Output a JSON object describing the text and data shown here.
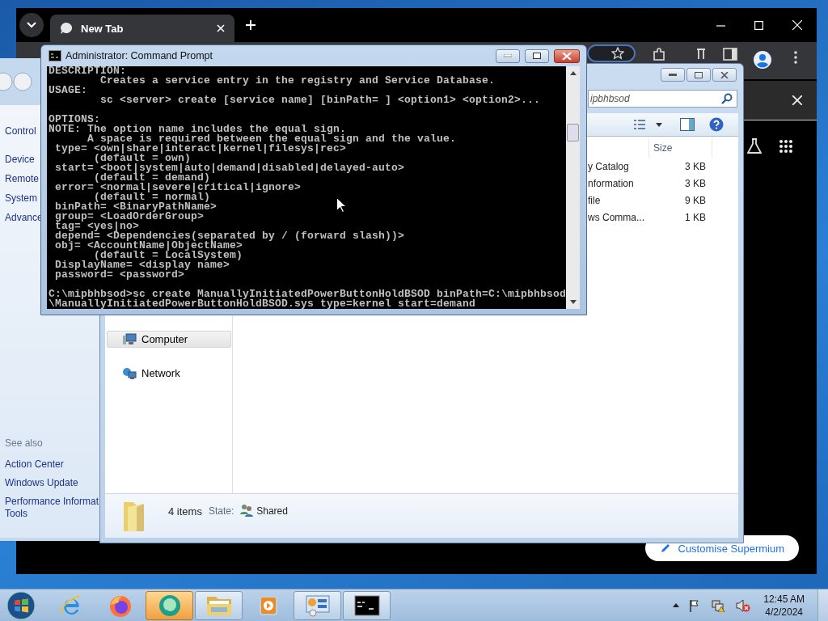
{
  "browser": {
    "tabs": [
      {
        "label": "New Tab",
        "selected": true
      }
    ],
    "customise_button": "Customise Supermium"
  },
  "control_panel": {
    "tasks": [
      "Control",
      "Device",
      "Remote",
      "System",
      "Advance"
    ],
    "see_also": {
      "heading": "See also",
      "links": [
        "Action Center",
        "Windows Update",
        "Performance Informat\nTools"
      ]
    }
  },
  "explorer": {
    "search": {
      "placeholder": "ipbhbsod"
    },
    "nav": [
      {
        "label": "Computer",
        "kind": "computer",
        "selected": true
      },
      {
        "label": "Network",
        "kind": "network",
        "selected": false
      }
    ],
    "columns": [
      "Size"
    ],
    "files": [
      {
        "name": "y Catalog",
        "size": "3 KB"
      },
      {
        "name": "nformation",
        "size": "3 KB"
      },
      {
        "name": "file",
        "size": "9 KB"
      },
      {
        "name": "ws Comma...",
        "size": "1 KB"
      }
    ],
    "status": {
      "count": "4 items",
      "state_label": "State:",
      "state": "Shared"
    }
  },
  "command_prompt": {
    "title": "Administrator: Command Prompt",
    "blocks": [
      [
        "DESCRIPTION:",
        "        Creates a service entry in the registry and Service Database.",
        "USAGE:",
        "        sc <server> create [service name] [binPath= ] <option1> <option2>..."
      ],
      [
        "OPTIONS:",
        "NOTE: The option name includes the equal sign.",
        "      A space is required between the equal sign and the value.",
        " type= <own|share|interact|kernel|filesys|rec>",
        "       (default = own)",
        " start= <boot|system|auto|demand|disabled|delayed-auto>",
        "       (default = demand)",
        " error= <normal|severe|critical|ignore>",
        "       (default = normal)",
        " binPath= <BinaryPathName>",
        " group= <LoadOrderGroup>",
        " tag= <yes|no>",
        " depend= <Dependencies(separated by / (forward slash))>",
        " obj= <AccountName|ObjectName>",
        "       (default = LocalSystem)",
        " DisplayName= <display name>",
        " password= <password>"
      ],
      [
        "C:\\mipbhbsod>sc create ManuallyInitiatedPowerButtonHoldBSOD binPath=C:\\mipbhbsod",
        "\\ManuallyInitiatedPowerButtonHoldBSOD.sys type=kernel start=demand"
      ]
    ]
  },
  "taskbar": {
    "apps": [
      {
        "kind": "ie",
        "running": false,
        "flashing": false
      },
      {
        "kind": "firefox",
        "running": false,
        "flashing": false
      },
      {
        "kind": "chat",
        "running": true,
        "flashing": true
      },
      {
        "kind": "folder",
        "running": true,
        "flashing": false
      },
      {
        "kind": "media",
        "running": false,
        "flashing": false
      },
      {
        "kind": "control",
        "running": true,
        "flashing": false
      },
      {
        "kind": "console",
        "running": true,
        "flashing": false
      }
    ],
    "clock": {
      "time": "12:45 AM",
      "date": "4/2/2024"
    }
  }
}
